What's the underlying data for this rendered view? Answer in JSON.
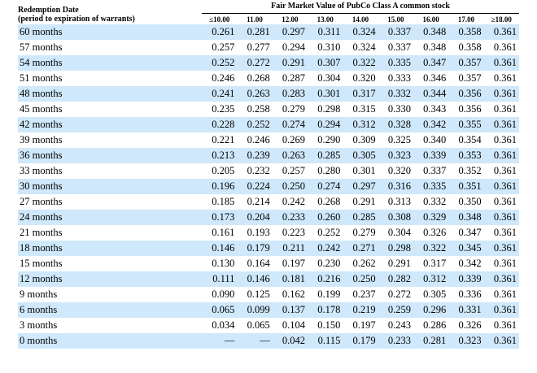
{
  "header": {
    "label_line1": "Redemption Date",
    "label_line2": "(period to expiration of warrants)",
    "group_title": "Fair Market Value of PubCo Class A common stock",
    "columns": [
      "≤10.00",
      "11.00",
      "12.00",
      "13.00",
      "14.00",
      "15.00",
      "16.00",
      "17.00",
      "≥18.00"
    ]
  },
  "rows": [
    {
      "label": "60 months",
      "values": [
        "0.261",
        "0.281",
        "0.297",
        "0.311",
        "0.324",
        "0.337",
        "0.348",
        "0.358",
        "0.361"
      ]
    },
    {
      "label": "57 months",
      "values": [
        "0.257",
        "0.277",
        "0.294",
        "0.310",
        "0.324",
        "0.337",
        "0.348",
        "0.358",
        "0.361"
      ]
    },
    {
      "label": "54 months",
      "values": [
        "0.252",
        "0.272",
        "0.291",
        "0.307",
        "0.322",
        "0.335",
        "0.347",
        "0.357",
        "0.361"
      ]
    },
    {
      "label": "51 months",
      "values": [
        "0.246",
        "0.268",
        "0.287",
        "0.304",
        "0.320",
        "0.333",
        "0.346",
        "0.357",
        "0.361"
      ]
    },
    {
      "label": "48 months",
      "values": [
        "0.241",
        "0.263",
        "0.283",
        "0.301",
        "0.317",
        "0.332",
        "0.344",
        "0.356",
        "0.361"
      ]
    },
    {
      "label": "45 months",
      "values": [
        "0.235",
        "0.258",
        "0.279",
        "0.298",
        "0.315",
        "0.330",
        "0.343",
        "0.356",
        "0.361"
      ]
    },
    {
      "label": "42 months",
      "values": [
        "0.228",
        "0.252",
        "0.274",
        "0.294",
        "0.312",
        "0.328",
        "0.342",
        "0.355",
        "0.361"
      ]
    },
    {
      "label": "39 months",
      "values": [
        "0.221",
        "0.246",
        "0.269",
        "0.290",
        "0.309",
        "0.325",
        "0.340",
        "0.354",
        "0.361"
      ]
    },
    {
      "label": "36 months",
      "values": [
        "0.213",
        "0.239",
        "0.263",
        "0.285",
        "0.305",
        "0.323",
        "0.339",
        "0.353",
        "0.361"
      ]
    },
    {
      "label": "33 months",
      "values": [
        "0.205",
        "0.232",
        "0.257",
        "0.280",
        "0.301",
        "0.320",
        "0.337",
        "0.352",
        "0.361"
      ]
    },
    {
      "label": "30 months",
      "values": [
        "0.196",
        "0.224",
        "0.250",
        "0.274",
        "0.297",
        "0.316",
        "0.335",
        "0.351",
        "0.361"
      ]
    },
    {
      "label": "27 months",
      "values": [
        "0.185",
        "0.214",
        "0.242",
        "0.268",
        "0.291",
        "0.313",
        "0.332",
        "0.350",
        "0.361"
      ]
    },
    {
      "label": "24 months",
      "values": [
        "0.173",
        "0.204",
        "0.233",
        "0.260",
        "0.285",
        "0.308",
        "0.329",
        "0.348",
        "0.361"
      ]
    },
    {
      "label": "21 months",
      "values": [
        "0.161",
        "0.193",
        "0.223",
        "0.252",
        "0.279",
        "0.304",
        "0.326",
        "0.347",
        "0.361"
      ]
    },
    {
      "label": "18 months",
      "values": [
        "0.146",
        "0.179",
        "0.211",
        "0.242",
        "0.271",
        "0.298",
        "0.322",
        "0.345",
        "0.361"
      ]
    },
    {
      "label": "15 months",
      "values": [
        "0.130",
        "0.164",
        "0.197",
        "0.230",
        "0.262",
        "0.291",
        "0.317",
        "0.342",
        "0.361"
      ]
    },
    {
      "label": "12 months",
      "values": [
        "0.111",
        "0.146",
        "0.181",
        "0.216",
        "0.250",
        "0.282",
        "0.312",
        "0.339",
        "0.361"
      ]
    },
    {
      "label": "9 months",
      "values": [
        "0.090",
        "0.125",
        "0.162",
        "0.199",
        "0.237",
        "0.272",
        "0.305",
        "0.336",
        "0.361"
      ]
    },
    {
      "label": "6 months",
      "values": [
        "0.065",
        "0.099",
        "0.137",
        "0.178",
        "0.219",
        "0.259",
        "0.296",
        "0.331",
        "0.361"
      ]
    },
    {
      "label": "3 months",
      "values": [
        "0.034",
        "0.065",
        "0.104",
        "0.150",
        "0.197",
        "0.243",
        "0.286",
        "0.326",
        "0.361"
      ]
    },
    {
      "label": "0 months",
      "values": [
        "—",
        "—",
        "0.042",
        "0.115",
        "0.179",
        "0.233",
        "0.281",
        "0.323",
        "0.361"
      ]
    }
  ]
}
